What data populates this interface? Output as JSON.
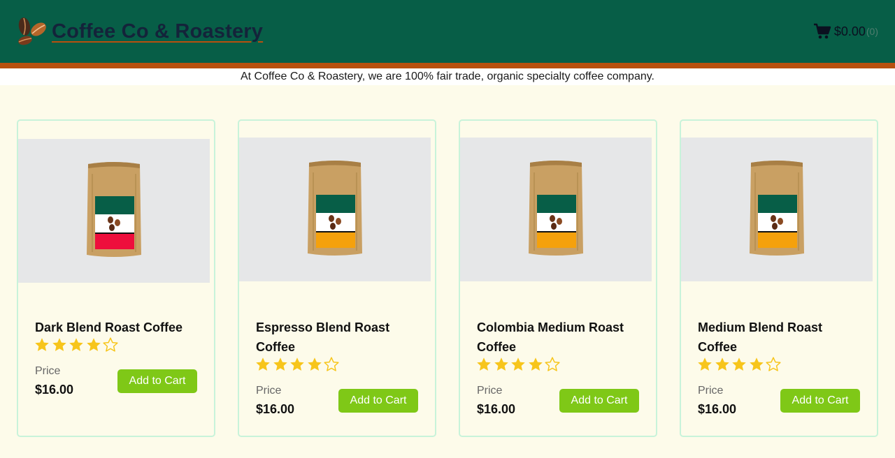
{
  "header": {
    "brand_title": "Coffee Co & Roastery",
    "cart_total": "$0.00",
    "cart_count": "(0)"
  },
  "tagline": "At Coffee Co & Roastery, we are 100% fair trade, organic specialty coffee company.",
  "colors": {
    "header_bg": "#075e47",
    "header_stripe": "#b8500e",
    "page_bg": "#fdfbea",
    "button_bg": "#7fc817",
    "star_fill": "#f7c51b"
  },
  "products": [
    {
      "name": "Dark Blend Roast Coffee",
      "rating": 4,
      "rating_max": 5,
      "price_label": "Price",
      "price": "$16.00",
      "button_label": "Add to Cart",
      "bag_label_color": "#ee0e3c"
    },
    {
      "name": "Espresso Blend Roast Coffee",
      "rating": 4,
      "rating_max": 5,
      "price_label": "Price",
      "price": "$16.00",
      "button_label": "Add to Cart",
      "bag_label_color": "#f5a10c"
    },
    {
      "name": "Colombia Medium Roast Coffee",
      "rating": 4,
      "rating_max": 5,
      "price_label": "Price",
      "price": "$16.00",
      "button_label": "Add to Cart",
      "bag_label_color": "#f5a10c"
    },
    {
      "name": "Medium Blend Roast Coffee",
      "rating": 4,
      "rating_max": 5,
      "price_label": "Price",
      "price": "$16.00",
      "button_label": "Add to Cart",
      "bag_label_color": "#f5a10c"
    }
  ]
}
